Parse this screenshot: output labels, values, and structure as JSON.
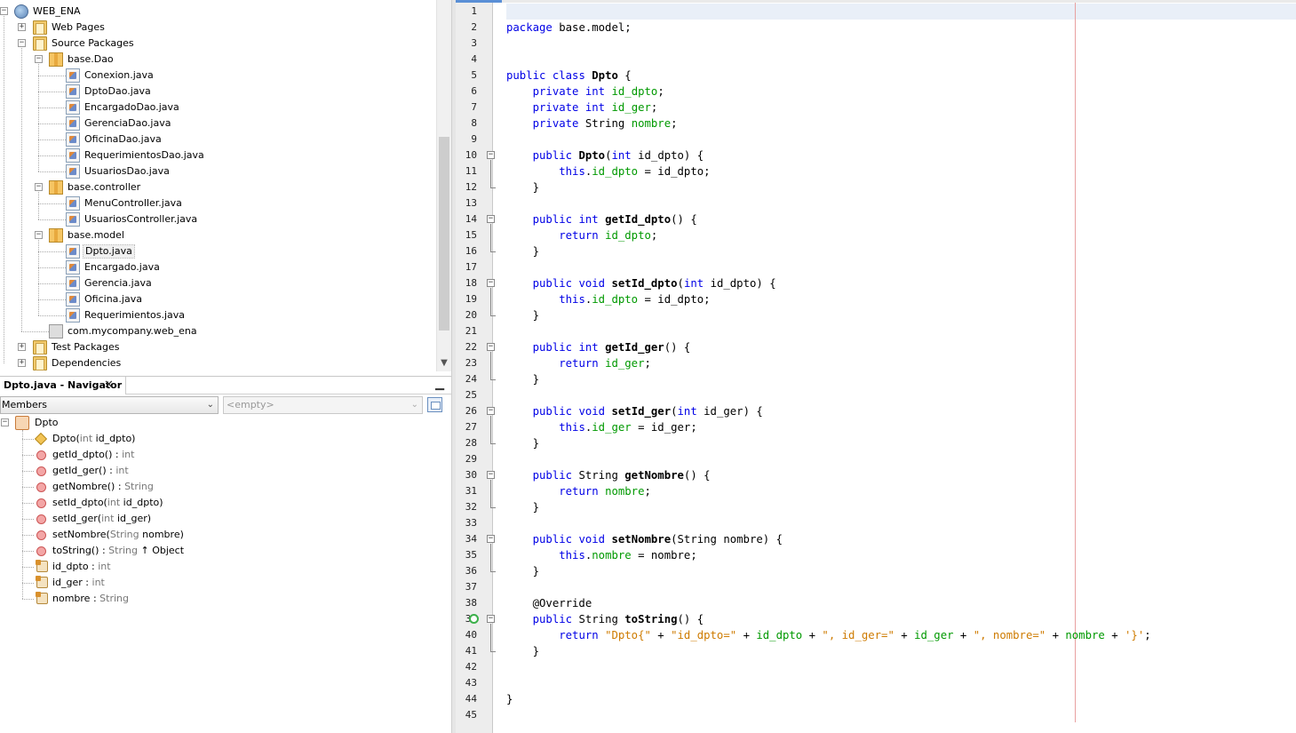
{
  "project_tree": [
    {
      "label": "WEB_ENA",
      "depth": 0,
      "icon": "project-icon",
      "toggle": "−"
    },
    {
      "label": "Web Pages",
      "depth": 1,
      "icon": "web-pages-folder-icon",
      "toggle": "+"
    },
    {
      "label": "Source Packages",
      "depth": 1,
      "icon": "source-folder-icon",
      "toggle": "−"
    },
    {
      "label": "base.Dao",
      "depth": 2,
      "icon": "package-icon",
      "toggle": "−"
    },
    {
      "label": "Conexion.java",
      "depth": 3,
      "icon": "java-file-icon",
      "toggle": ""
    },
    {
      "label": "DptoDao.java",
      "depth": 3,
      "icon": "java-file-icon",
      "toggle": ""
    },
    {
      "label": "EncargadoDao.java",
      "depth": 3,
      "icon": "java-file-icon",
      "toggle": ""
    },
    {
      "label": "GerenciaDao.java",
      "depth": 3,
      "icon": "java-file-icon",
      "toggle": ""
    },
    {
      "label": "OficinaDao.java",
      "depth": 3,
      "icon": "java-file-icon",
      "toggle": ""
    },
    {
      "label": "RequerimientosDao.java",
      "depth": 3,
      "icon": "java-file-icon",
      "toggle": ""
    },
    {
      "label": "UsuariosDao.java",
      "depth": 3,
      "icon": "java-file-icon",
      "toggle": ""
    },
    {
      "label": "base.controller",
      "depth": 2,
      "icon": "package-icon",
      "toggle": "−"
    },
    {
      "label": "MenuController.java",
      "depth": 3,
      "icon": "java-file-icon",
      "toggle": ""
    },
    {
      "label": "UsuariosController.java",
      "depth": 3,
      "icon": "java-file-icon",
      "toggle": ""
    },
    {
      "label": "base.model",
      "depth": 2,
      "icon": "package-icon",
      "toggle": "−"
    },
    {
      "label": "Dpto.java",
      "depth": 3,
      "icon": "java-file-icon",
      "toggle": "",
      "selected": true
    },
    {
      "label": "Encargado.java",
      "depth": 3,
      "icon": "java-file-icon",
      "toggle": ""
    },
    {
      "label": "Gerencia.java",
      "depth": 3,
      "icon": "java-file-icon",
      "toggle": ""
    },
    {
      "label": "Oficina.java",
      "depth": 3,
      "icon": "java-file-icon",
      "toggle": ""
    },
    {
      "label": "Requerimientos.java",
      "depth": 3,
      "icon": "java-file-icon",
      "toggle": ""
    },
    {
      "label": "com.mycompany.web_ena",
      "depth": 2,
      "icon": "empty-package-icon",
      "toggle": ""
    },
    {
      "label": "Test Packages",
      "depth": 1,
      "icon": "test-folder-icon",
      "toggle": "+"
    },
    {
      "label": "Dependencies",
      "depth": 1,
      "icon": "dependencies-folder-icon",
      "toggle": "+"
    }
  ],
  "navigator": {
    "title": "Dpto.java - Navigator",
    "close_glyph": "✕",
    "minimize_glyph": "▁",
    "members_label": "Members",
    "filter_value": "<empty>",
    "dropdown_glyph": "⌄",
    "root": {
      "label": "Dpto",
      "toggle": "−"
    },
    "members": [
      {
        "icon": "constructor-icon",
        "name": "Dpto(",
        "type": "int",
        "rest": " id_dpto)"
      },
      {
        "icon": "method-icon",
        "name": "getId_dpto() : ",
        "type": "int",
        "rest": ""
      },
      {
        "icon": "method-icon",
        "name": "getId_ger() : ",
        "type": "int",
        "rest": ""
      },
      {
        "icon": "method-icon",
        "name": "getNombre() : ",
        "type": "String",
        "rest": ""
      },
      {
        "icon": "method-icon",
        "name": "setId_dpto(",
        "type": "int",
        "rest": " id_dpto)"
      },
      {
        "icon": "method-icon",
        "name": "setId_ger(",
        "type": "int",
        "rest": " id_ger)"
      },
      {
        "icon": "method-icon",
        "name": "setNombre(",
        "type": "String",
        "rest": " nombre)"
      },
      {
        "icon": "method-icon",
        "name": "toString() : ",
        "type": "String",
        "rest": " ↑ Object"
      },
      {
        "icon": "field-icon",
        "name": "id_dpto : ",
        "type": "int",
        "rest": ""
      },
      {
        "icon": "field-icon",
        "name": "id_ger : ",
        "type": "int",
        "rest": ""
      },
      {
        "icon": "field-icon",
        "name": "nombre : ",
        "type": "String",
        "rest": ""
      }
    ]
  },
  "editor": {
    "current_line": 1,
    "override_marker_line": 39,
    "folds": [
      {
        "start": 10,
        "end": 12
      },
      {
        "start": 14,
        "end": 16
      },
      {
        "start": 18,
        "end": 20
      },
      {
        "start": 22,
        "end": 24
      },
      {
        "start": 26,
        "end": 28
      },
      {
        "start": 30,
        "end": 32
      },
      {
        "start": 34,
        "end": 36
      },
      {
        "start": 39,
        "end": 41
      }
    ],
    "lines": [
      [],
      [
        [
          "kw",
          "package"
        ],
        [
          "",
          "base.model;"
        ]
      ],
      [],
      [],
      [
        [
          "kw",
          "public"
        ],
        [
          "kw",
          "class"
        ],
        [
          "b",
          "Dpto"
        ],
        [
          "",
          "{"
        ]
      ],
      [
        [
          "",
          "    "
        ],
        [
          "kw",
          "private"
        ],
        [
          "kw",
          "int"
        ],
        [
          "fd",
          "id_dpto"
        ],
        [
          "",
          ";"
        ]
      ],
      [
        [
          "",
          "    "
        ],
        [
          "kw",
          "private"
        ],
        [
          "kw",
          "int"
        ],
        [
          "fd",
          "id_ger"
        ],
        [
          "",
          ";"
        ]
      ],
      [
        [
          "",
          "    "
        ],
        [
          "kw",
          "private"
        ],
        [
          "",
          "String"
        ],
        [
          "fd",
          "nombre"
        ],
        [
          "",
          ";"
        ]
      ],
      [],
      [
        [
          "",
          "    "
        ],
        [
          "kw",
          "public"
        ],
        [
          "b",
          "Dpto"
        ],
        [
          "",
          "("
        ],
        [
          "kw",
          "int"
        ],
        [
          "",
          "id_dpto) {"
        ]
      ],
      [
        [
          "",
          "        "
        ],
        [
          "kw",
          "this"
        ],
        [
          "",
          ".",
          ""
        ],
        [
          "fd",
          "id_dpto"
        ],
        [
          "",
          "= id_dpto;"
        ]
      ],
      [
        [
          "",
          "    }"
        ]
      ],
      [],
      [
        [
          "",
          "    "
        ],
        [
          "kw",
          "public"
        ],
        [
          "kw",
          "int"
        ],
        [
          "b",
          "getId_dpto"
        ],
        [
          "",
          "() {"
        ]
      ],
      [
        [
          "",
          "        "
        ],
        [
          "kw",
          "return"
        ],
        [
          "fd",
          "id_dpto"
        ],
        [
          "",
          ";"
        ]
      ],
      [
        [
          "",
          "    }"
        ]
      ],
      [],
      [
        [
          "",
          "    "
        ],
        [
          "kw",
          "public"
        ],
        [
          "kw",
          "void"
        ],
        [
          "b",
          "setId_dpto"
        ],
        [
          "",
          "("
        ],
        [
          "kw",
          "int"
        ],
        [
          "",
          "id_dpto) {"
        ]
      ],
      [
        [
          "",
          "        "
        ],
        [
          "kw",
          "this"
        ],
        [
          "",
          ".",
          ""
        ],
        [
          "fd",
          "id_dpto"
        ],
        [
          "",
          "= id_dpto;"
        ]
      ],
      [
        [
          "",
          "    }"
        ]
      ],
      [],
      [
        [
          "",
          "    "
        ],
        [
          "kw",
          "public"
        ],
        [
          "kw",
          "int"
        ],
        [
          "b",
          "getId_ger"
        ],
        [
          "",
          "() {"
        ]
      ],
      [
        [
          "",
          "        "
        ],
        [
          "kw",
          "return"
        ],
        [
          "fd",
          "id_ger"
        ],
        [
          "",
          ";"
        ]
      ],
      [
        [
          "",
          "    }"
        ]
      ],
      [],
      [
        [
          "",
          "    "
        ],
        [
          "kw",
          "public"
        ],
        [
          "kw",
          "void"
        ],
        [
          "b",
          "setId_ger"
        ],
        [
          "",
          "("
        ],
        [
          "kw",
          "int"
        ],
        [
          "",
          "id_ger) {"
        ]
      ],
      [
        [
          "",
          "        "
        ],
        [
          "kw",
          "this"
        ],
        [
          "",
          ".",
          ""
        ],
        [
          "fd",
          "id_ger"
        ],
        [
          "",
          "= id_ger;"
        ]
      ],
      [
        [
          "",
          "    }"
        ]
      ],
      [],
      [
        [
          "",
          "    "
        ],
        [
          "kw",
          "public"
        ],
        [
          "",
          "String"
        ],
        [
          "b",
          "getNombre"
        ],
        [
          "",
          "() {"
        ]
      ],
      [
        [
          "",
          "        "
        ],
        [
          "kw",
          "return"
        ],
        [
          "fd",
          "nombre"
        ],
        [
          "",
          ";"
        ]
      ],
      [
        [
          "",
          "    }"
        ]
      ],
      [],
      [
        [
          "",
          "    "
        ],
        [
          "kw",
          "public"
        ],
        [
          "kw",
          "void"
        ],
        [
          "b",
          "setNombre"
        ],
        [
          "",
          "(String nombre) {"
        ]
      ],
      [
        [
          "",
          "        "
        ],
        [
          "kw",
          "this"
        ],
        [
          "",
          ".",
          ""
        ],
        [
          "fd",
          "nombre"
        ],
        [
          "",
          "= nombre;"
        ]
      ],
      [
        [
          "",
          "    }"
        ]
      ],
      [],
      [
        [
          "",
          "    @Override"
        ]
      ],
      [
        [
          "",
          "    "
        ],
        [
          "kw",
          "public"
        ],
        [
          "",
          "String"
        ],
        [
          "b",
          "toString"
        ],
        [
          "",
          "() {"
        ]
      ],
      [
        [
          "",
          "        "
        ],
        [
          "kw",
          "return"
        ],
        [
          "st",
          "\"Dpto{\""
        ],
        [
          "",
          "+"
        ],
        [
          "st",
          "\"id_dpto=\""
        ],
        [
          "",
          "+"
        ],
        [
          "fd",
          "id_dpto"
        ],
        [
          "",
          "+"
        ],
        [
          "st",
          "\", id_ger=\""
        ],
        [
          "",
          "+"
        ],
        [
          "fd",
          "id_ger"
        ],
        [
          "",
          "+"
        ],
        [
          "st",
          "\", nombre=\""
        ],
        [
          "",
          "+"
        ],
        [
          "fd",
          "nombre"
        ],
        [
          "",
          "+"
        ],
        [
          "st",
          "'}'"
        ],
        [
          "",
          ";"
        ]
      ],
      [
        [
          "",
          "    }"
        ]
      ],
      [],
      [],
      [
        [
          "",
          "}"
        ]
      ],
      []
    ]
  }
}
